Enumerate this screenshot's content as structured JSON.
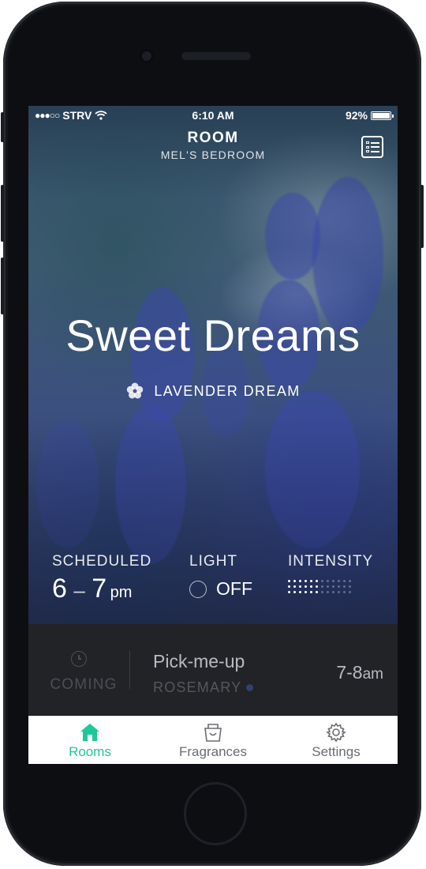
{
  "status_bar": {
    "carrier": "STRV",
    "time": "6:10 AM",
    "battery": "92%",
    "battery_level": 0.92
  },
  "header": {
    "title": "ROOM",
    "subtitle": "MEL'S BEDROOM"
  },
  "mood": {
    "title": "Sweet Dreams",
    "fragrance": "LAVENDER DREAM"
  },
  "stats": {
    "scheduled_label": "SCHEDULED",
    "scheduled_start": "6",
    "scheduled_sep": "–",
    "scheduled_end": "7",
    "scheduled_suffix": "pm",
    "light_label": "LIGHT",
    "light_value": "OFF",
    "intensity_label": "INTENSITY",
    "intensity_level": 0.5
  },
  "upcoming": {
    "status_label": "COMING",
    "name": "Pick-me-up",
    "fragrance": "ROSEMARY",
    "fragrance_color": "#31416b",
    "time_range": "7-8",
    "time_suffix": "am"
  },
  "tabs": [
    {
      "label": "Rooms",
      "icon": "home-icon",
      "active": true
    },
    {
      "label": "Fragrances",
      "icon": "basket-icon",
      "active": false
    },
    {
      "label": "Settings",
      "icon": "gear-icon",
      "active": false
    }
  ],
  "colors": {
    "accent": "#1ec89a",
    "upcoming_bg": "#222327",
    "hero_tint": "#3b4f7f"
  }
}
